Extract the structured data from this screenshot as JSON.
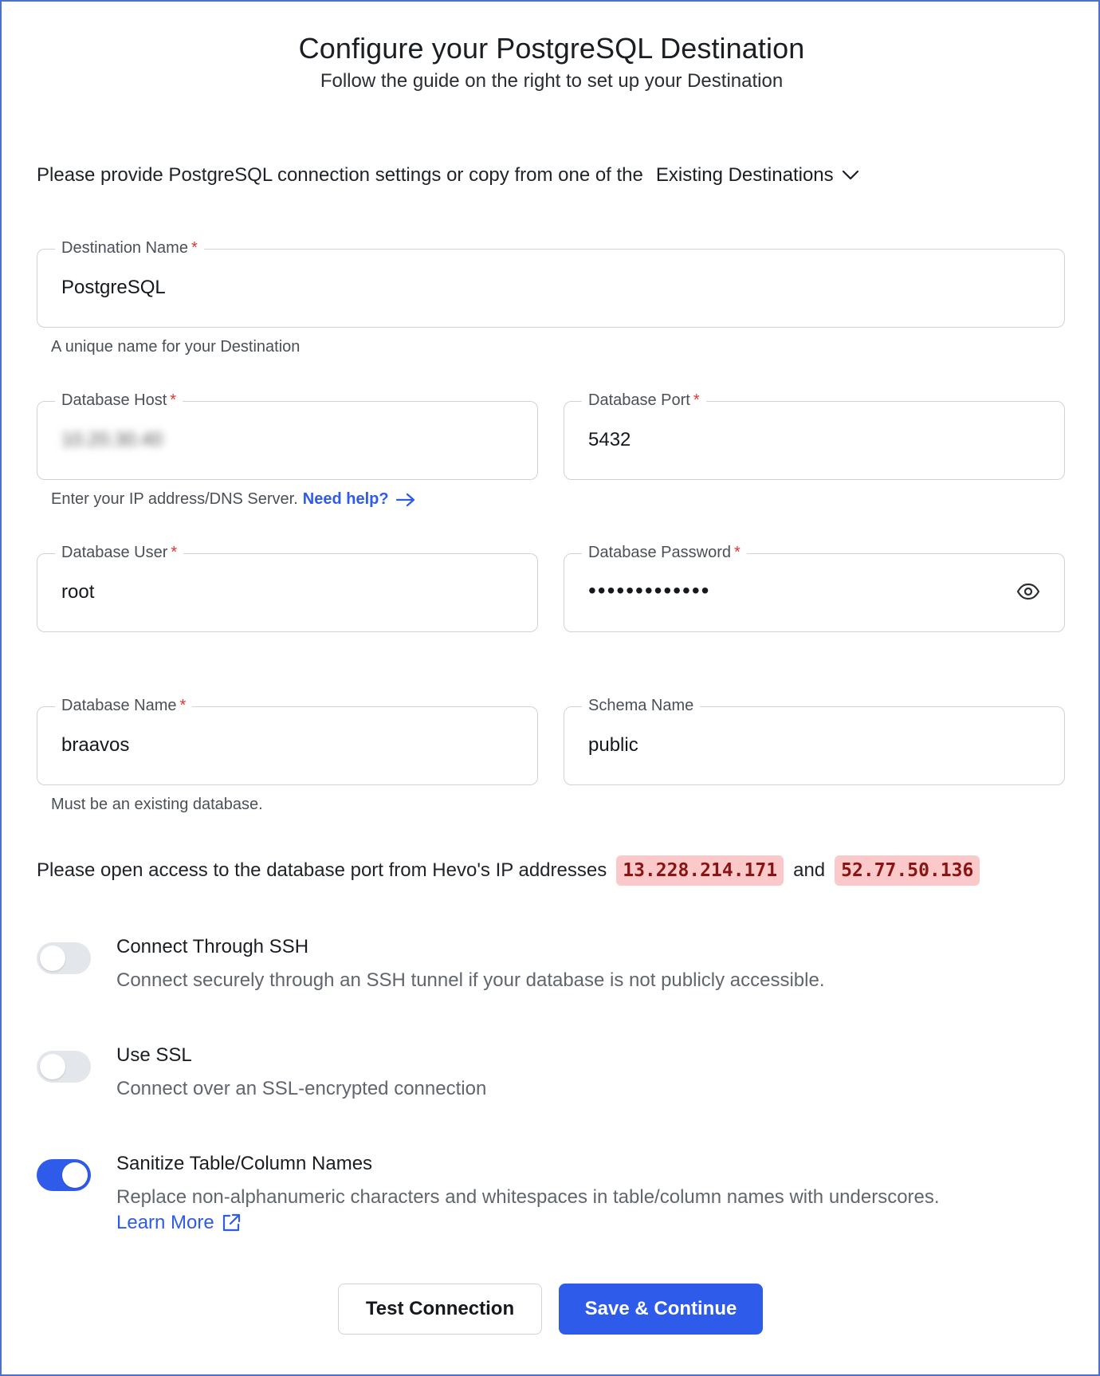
{
  "header": {
    "title": "Configure your PostgreSQL Destination",
    "subtitle": "Follow the guide on the right to set up your Destination"
  },
  "intro": {
    "text": "Please provide PostgreSQL connection settings or copy from one of the",
    "existing_label": "Existing Destinations",
    "existing_icon": "chevron-down-icon"
  },
  "fields": {
    "destination_name": {
      "label": "Destination Name",
      "required": "*",
      "value": "PostgreSQL",
      "hint": "A unique name for your Destination"
    },
    "database_host": {
      "label": "Database Host",
      "required": "*",
      "value": "10.20.30.40",
      "hint": "Enter your IP address/DNS Server.",
      "help_link": "Need help?"
    },
    "database_port": {
      "label": "Database Port",
      "required": "*",
      "value": "5432"
    },
    "database_user": {
      "label": "Database User",
      "required": "*",
      "value": "root"
    },
    "database_password": {
      "label": "Database Password",
      "required": "*",
      "value": "•••••••••••••",
      "eye_icon": "eye-icon"
    },
    "database_name": {
      "label": "Database Name",
      "required": "*",
      "value": "braavos",
      "hint": "Must be an existing database."
    },
    "schema_name": {
      "label": "Schema Name",
      "value": "public"
    }
  },
  "ip_access": {
    "text": "Please open access to the database port from Hevo's IP addresses",
    "ip1": "13.228.214.171",
    "conjunction": "and",
    "ip2": "52.77.50.136"
  },
  "toggles": {
    "ssh": {
      "title": "Connect Through SSH",
      "description": "Connect securely through an SSH tunnel if your database is not publicly accessible.",
      "enabled": false
    },
    "ssl": {
      "title": "Use SSL",
      "description": "Connect over an SSL-encrypted connection",
      "enabled": false
    },
    "sanitize": {
      "title": "Sanitize Table/Column Names",
      "description": "Replace non-alphanumeric characters and whitespaces in table/column names with underscores.",
      "learn_more": "Learn More",
      "enabled": true
    }
  },
  "actions": {
    "test_label": "Test Connection",
    "save_label": "Save & Continue"
  },
  "colors": {
    "accent": "#2f5bea",
    "required": "#e0342f",
    "ip_bg": "#fbc9c9",
    "ip_text": "#8a1414",
    "frame_border": "#4a73c8"
  }
}
